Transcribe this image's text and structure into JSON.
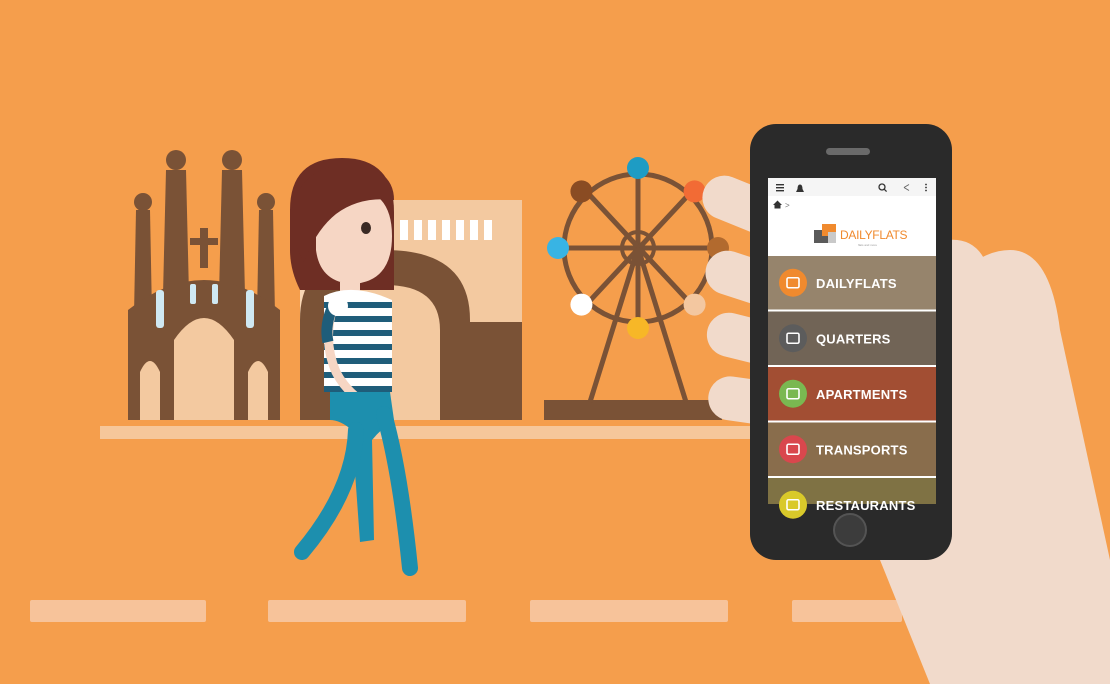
{
  "colors": {
    "background": "#F59E4C",
    "building": "#7A5236",
    "building_light": "#F3C9A0",
    "window_blue": "#CFE8F2",
    "ground": "#F6C79A",
    "phone_body": "#2A2A2A",
    "hand": "#F1DACB",
    "hair": "#6E2E24",
    "skin": "#F6D6C4",
    "stripe": "#1F5D7A",
    "legs": "#1D8FAE"
  },
  "app": {
    "brand_name": "DAILYFLATS",
    "brand_tagline": "flats and more",
    "status_icons": [
      "hamburger-menu-icon",
      "bell-icon",
      "search-icon",
      "share-icon",
      "more-vertical-icon"
    ],
    "breadcrumb": [
      "home-icon",
      ">"
    ],
    "menu": [
      {
        "label": "DAILYFLATS",
        "icon": "building-blocks-icon",
        "icon_color": "#F08A2E",
        "bg": "#B8A184"
      },
      {
        "label": "QUARTERS",
        "icon": "map-tiles-icon",
        "icon_color": "#5C5C5C",
        "bg": "#8A7B6A"
      },
      {
        "label": "APARTMENTS",
        "icon": "apartment-building-icon",
        "icon_color": "#7AB851",
        "bg": "#C6603F"
      },
      {
        "label": "TRANSPORTS",
        "icon": "bus-icon",
        "icon_color": "#D9474D",
        "bg": "#A8855D"
      },
      {
        "label": "RESTAURANTS",
        "icon": "cutlery-icon",
        "icon_color": "#D9C92A",
        "bg": "#9C8C53"
      }
    ]
  },
  "ferris_wheel_gondolas": [
    "#1E9CC4",
    "#F26B35",
    "#B26A2E",
    "#F3C7A0",
    "#F7B727",
    "#FFFFFF",
    "#38B4E4",
    "#8A4C23"
  ]
}
